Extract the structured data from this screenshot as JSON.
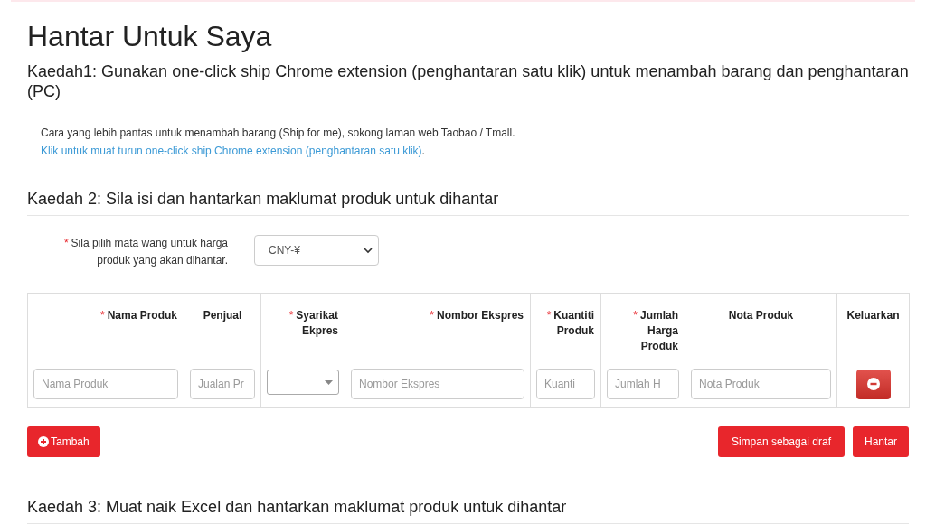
{
  "title": "Hantar Untuk Saya",
  "method1": {
    "heading": "Kaedah1: Gunakan one-click ship Chrome extension (penghantaran satu klik) untuk menambah barang dan penghantaran (PC)",
    "text": "Cara yang lebih pantas untuk menambah barang (Ship for me), sokong laman web Taobao / Tmall. ",
    "link": "Klik untuk muat turun one-click ship Chrome extension (penghantaran satu klik)",
    "after": "."
  },
  "method2": {
    "heading": "Kaedah 2: Sila isi dan hantarkan maklumat produk untuk dihantar",
    "currency_label": "Sila pilih mata wang untuk harga produk yang akan dihantar.",
    "currency_required_mark": "*",
    "currency_value": "CNY-¥"
  },
  "table": {
    "columns": [
      {
        "label": "Nama Produk",
        "required_mark": "*"
      },
      {
        "label": "Penjual"
      },
      {
        "label": "Syarikat Ekpres",
        "required_mark": "*"
      },
      {
        "label": "Nombor Ekspres",
        "required_mark": "*"
      },
      {
        "label": "Kuantiti Produk",
        "required_mark": "*"
      },
      {
        "label": "Jumlah Harga Produk",
        "required_mark": "*"
      },
      {
        "label": "Nota Produk"
      },
      {
        "label": "Keluarkan"
      }
    ],
    "rows": [
      [
        {
          "kind": "input",
          "placeholder": "Nama Produk"
        },
        {
          "kind": "input",
          "placeholder": "Jualan Pr"
        },
        {
          "kind": "select"
        },
        {
          "kind": "input",
          "placeholder": "Nombor Ekspres"
        },
        {
          "kind": "input",
          "placeholder": "Kuanti"
        },
        {
          "kind": "input",
          "placeholder": "Jumlah H"
        },
        {
          "kind": "input",
          "placeholder": "Nota Produk"
        },
        {
          "kind": "remove"
        }
      ]
    ]
  },
  "add_button": "Tambah",
  "save_draft_button": "Simpan sebagai draf",
  "submit_button": "Hantar",
  "method3": {
    "heading": "Kaedah 3: Muat naik Excel dan hantarkan maklumat produk untuk dihantar"
  }
}
